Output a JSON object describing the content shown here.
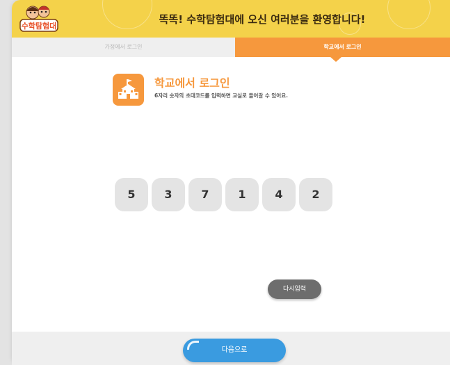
{
  "header": {
    "title": "똑똑! 수학탐험대에 오신 여러분을 환영합니다!",
    "logo_text": "수학탐험대"
  },
  "tabs": [
    {
      "label": "가정에서 로그인",
      "active": false
    },
    {
      "label": "학교에서 로그인",
      "active": true
    }
  ],
  "login": {
    "title": "학교에서 로그인",
    "description": "6자리 숫자의 초대코드를 입력하면 교실로 들어갈 수 있어요.",
    "icon": "school-icon"
  },
  "code": {
    "digits": [
      "5",
      "3",
      "7",
      "1",
      "4",
      "2"
    ]
  },
  "buttons": {
    "reset_label": "다시입력",
    "next_label": "다음으로"
  },
  "colors": {
    "header_yellow": "#f4d24a",
    "accent_orange": "#f6983d",
    "next_blue": "#3a9be0",
    "reset_gray": "#6d6d6d"
  }
}
